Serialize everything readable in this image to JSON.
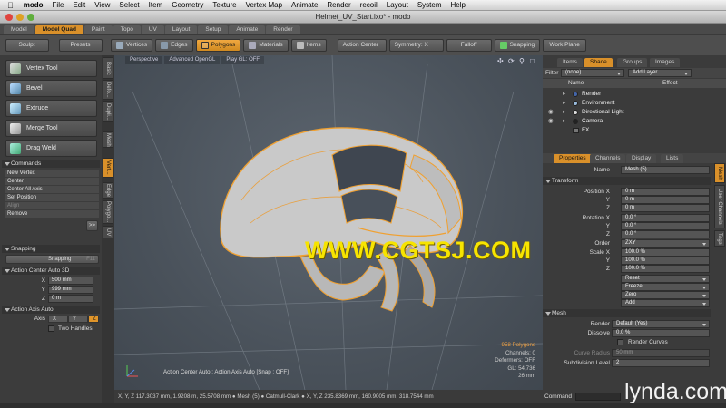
{
  "menubar": {
    "apple": "",
    "items": [
      "modo",
      "File",
      "Edit",
      "View",
      "Select",
      "Item",
      "Geometry",
      "Texture",
      "Vertex Map",
      "Animate",
      "Render",
      "recoil",
      "Layout",
      "System",
      "Help"
    ]
  },
  "window": {
    "title": "Helmet_UV_Start.lxo* - modo"
  },
  "layout_tabs": [
    "Model",
    "Model Quad",
    "Paint",
    "Topo",
    "UV",
    "Layout",
    "Setup",
    "Animate",
    "Render"
  ],
  "layout_tabs_active": 1,
  "left_top": {
    "sculpt": "Sculpt",
    "presets": "Presets"
  },
  "toolbar": {
    "vertices": "Vertices",
    "edges": "Edges",
    "polygons": "Polygons",
    "materials": "Materials",
    "items": "Items",
    "action_center": "Action Center",
    "symmetry": "Symmetry: X",
    "falloff": "Falloff",
    "snapping": "Snapping",
    "work_plane": "Work Plane"
  },
  "tools": [
    "Vertex Tool",
    "Bevel",
    "Extrude",
    "Merge Tool",
    "Drag Weld"
  ],
  "commands": {
    "header": "Commands",
    "items": [
      "New Vertex",
      "Center",
      "Center All Axis",
      "Set Position",
      "Align",
      "Remove"
    ]
  },
  "expand_btn": ">>",
  "side_tabs": [
    "Basic",
    "Defo...",
    "Dupli...",
    "Mesh",
    "Vert...",
    "Edge",
    "Polygo...",
    "UV"
  ],
  "snapping": {
    "header": "Snapping",
    "button": "Snapping",
    "key": "F11"
  },
  "action_center": {
    "header": "Action Center Auto 3D",
    "x_label": "X",
    "x_value": "500 mm",
    "y_label": "Y",
    "y_value": "999 mm",
    "z_label": "Z",
    "z_value": "0 m"
  },
  "action_axis": {
    "header": "Action Axis Auto",
    "axis_label": "Axis",
    "x": "X",
    "y": "Y",
    "z": "Z",
    "two_handles": "Two Handles"
  },
  "viewport": {
    "view": "Perspective",
    "renderer": "Advanced OpenGL",
    "play": "Play GL: OFF",
    "hud": "Action Center Auto : Action Axis Auto [Snap : OFF]",
    "stats": [
      "958 Polygons",
      "Channels: 0",
      "Deformers: OFF",
      "GL: 54,736",
      "26 mm"
    ]
  },
  "watermark": "WWW.CGTSJ.COM",
  "right_tabs": {
    "items": "Items",
    "shade": "Shade",
    "groups": "Groups",
    "images": "Images"
  },
  "shader_tree": {
    "filter_label": "Filter",
    "filter_value": "(none)",
    "add_layer": "Add Layer",
    "col_name": "Name",
    "col_effect": "Effect",
    "rows": [
      "Render",
      "Environment",
      "Directional Light",
      "Camera",
      "FX"
    ]
  },
  "props_tabs": {
    "properties": "Properties",
    "channels": "Channels",
    "display": "Display",
    "lists": "Lists"
  },
  "properties": {
    "name_label": "Name",
    "name_value": "Mesh (5)",
    "transform_header": "Transform",
    "position_label": "Position X",
    "pos_x": "0 m",
    "pos_y": "0 m",
    "pos_z": "0 m",
    "rotation_label": "Rotation X",
    "rot_x": "0.0 °",
    "rot_y": "0.0 °",
    "rot_z": "0.0 °",
    "order_label": "Order",
    "order_value": "ZXY",
    "scale_label": "Scale X",
    "scl_x": "100.0 %",
    "scl_y": "100.0 %",
    "scl_z": "100.0 %",
    "y": "Y",
    "z": "Z",
    "reset": "Reset",
    "freeze": "Freeze",
    "zero": "Zero",
    "add": "Add",
    "mesh_header": "Mesh",
    "render_label": "Render",
    "render_value": "Default (Yes)",
    "dissolve_label": "Dissolve",
    "dissolve_value": "0.0 %",
    "render_curves": "Render Curves",
    "curve_radius_label": "Curve Radius",
    "curve_radius_value": "50 mm",
    "subdiv_label": "Subdivision Level",
    "subdiv_value": "2"
  },
  "right_side_tabs": [
    "Mesh",
    "User Channels",
    "Tags"
  ],
  "status": {
    "text": "X, Y, Z   117.3037 mm, 1.9208 m, 25.5708 mm  ● Mesh (5)  ● Catmull-Clark  ● X, Y, Z   235.8369 mm, 160.9005 mm, 318.7544 mm"
  },
  "command_label": "Command",
  "brand": "lynda.com",
  "colors": {
    "accent": "#d9902a",
    "watermark": "#f7e400",
    "wire": "#f0a030"
  }
}
